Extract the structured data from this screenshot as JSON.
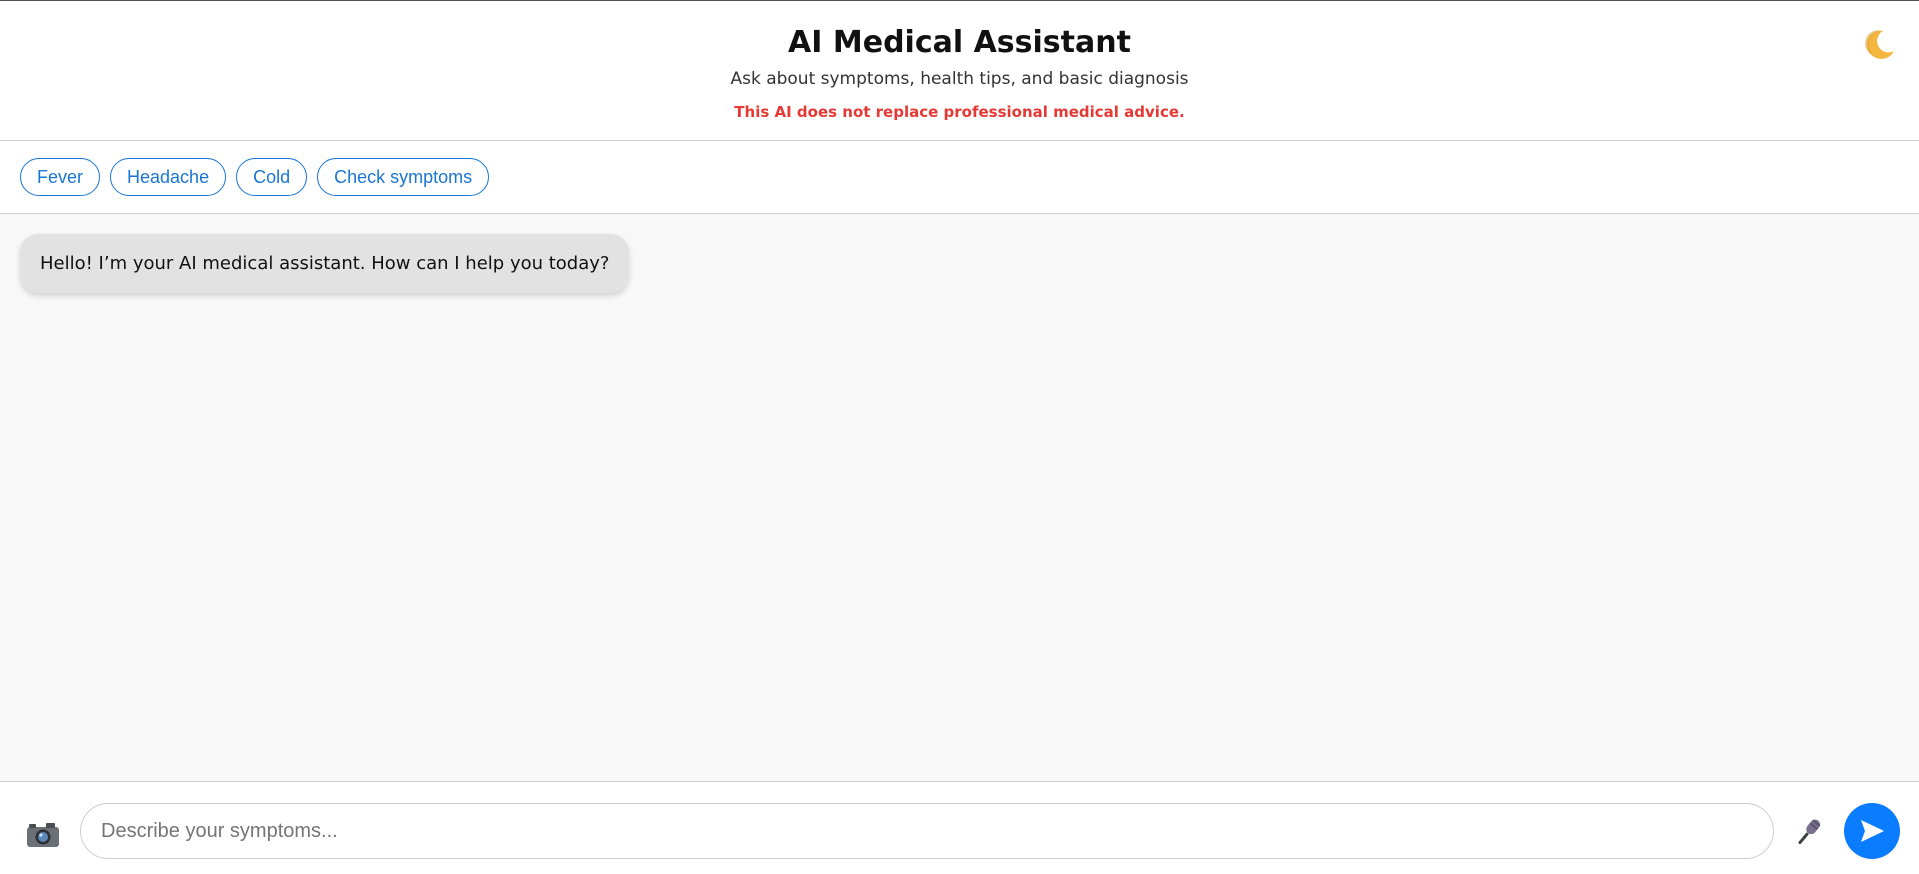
{
  "header": {
    "title": "AI Medical Assistant",
    "subtitle": "Ask about symptoms, health tips, and basic diagnosis",
    "disclaimer": "This AI does not replace professional medical advice.",
    "theme_icon": "moon-icon"
  },
  "chips": [
    {
      "label": "Fever"
    },
    {
      "label": "Headache"
    },
    {
      "label": "Cold"
    },
    {
      "label": "Check symptoms"
    }
  ],
  "chat": {
    "messages": [
      {
        "role": "assistant",
        "text": "Hello! I’m your AI medical assistant. How can I help you today?"
      }
    ]
  },
  "input": {
    "placeholder": "Describe your symptoms...",
    "value": "",
    "camera_icon": "camera-icon",
    "mic_icon": "microphone-icon",
    "send_icon": "send-icon"
  },
  "colors": {
    "accent": "#1976d2",
    "send": "#0a7cff",
    "warning": "#e53935",
    "bubble": "#e2e2e2",
    "chat_bg": "#f8f8f8"
  }
}
